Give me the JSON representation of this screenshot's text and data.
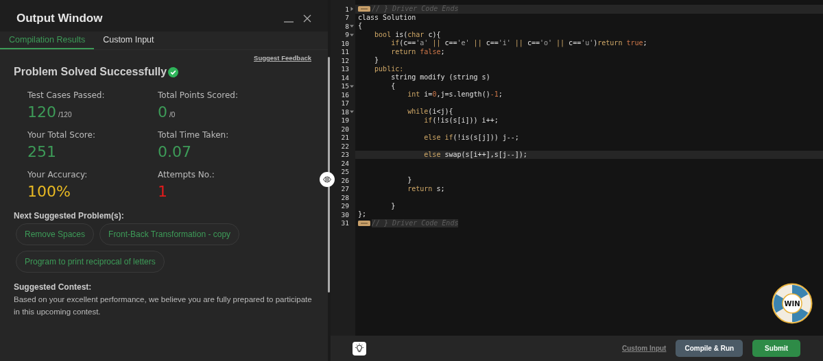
{
  "output_window": {
    "title": "Output Window",
    "tabs": [
      {
        "label": "Compilation Results",
        "selected": true
      },
      {
        "label": "Custom Input",
        "selected": false
      }
    ],
    "feedback_link": "Suggest Feedback",
    "status": "Problem Solved Successfully",
    "stats": [
      {
        "label": "Test Cases Passed:",
        "value": "120",
        "suffix": "/120",
        "color": "#3d9b58"
      },
      {
        "label": "Total Points Scored:",
        "value": "0",
        "suffix": "/0",
        "color": "#3d9b58"
      },
      {
        "label": "Your Total Score:",
        "value": "251",
        "color": "#3d9b58"
      },
      {
        "label": "Total Time Taken:",
        "value": "0.07",
        "color": "#3d9b58"
      },
      {
        "label": "Your Accuracy:",
        "value": "100%",
        "color": "#e8b923"
      },
      {
        "label": "Attempts No.:",
        "value": "1",
        "color": "#e41b1b"
      }
    ],
    "suggested_heading": "Next Suggested Problem(s):",
    "suggested_problems": [
      "Remove Spaces",
      "Front-Back Transformation - copy",
      "Program to print reciprocal of letters"
    ],
    "contest_heading": "Suggested Contest:",
    "contest_text": "Based on your excellent performance, we believe you are fully prepared to participate in this upcoming contest."
  },
  "editor": {
    "lines": [
      {
        "number": "1",
        "foldable": true,
        "collapsed": true,
        "active": true,
        "tokens": [
          {
            "kind": "comment",
            "text": "// } Driver Code Ends"
          }
        ]
      },
      {
        "number": "7",
        "foldable": false,
        "collapsed": false,
        "active": false,
        "tokens": [
          {
            "kind": "plain",
            "text": "class Solution"
          }
        ]
      },
      {
        "number": "8",
        "foldable": true,
        "collapsed": false,
        "active": false,
        "tokens": [
          {
            "kind": "plain",
            "text": "{"
          }
        ]
      },
      {
        "number": "9",
        "foldable": true,
        "collapsed": false,
        "active": false,
        "tokens": [
          {
            "kind": "keyword",
            "text": "    bool"
          },
          {
            "kind": "plain",
            "text": " is("
          },
          {
            "kind": "keyword",
            "text": "char"
          },
          {
            "kind": "plain",
            "text": " c){"
          }
        ]
      },
      {
        "number": "10",
        "foldable": false,
        "collapsed": false,
        "active": false,
        "tokens": [
          {
            "kind": "keyword",
            "text": "        if"
          },
          {
            "kind": "plain",
            "text": "(c=="
          },
          {
            "kind": "string",
            "text": "'a'"
          },
          {
            "kind": "keyword",
            "text": " ||"
          },
          {
            "kind": "plain",
            "text": " c=="
          },
          {
            "kind": "string",
            "text": "'e'"
          },
          {
            "kind": "keyword",
            "text": " ||"
          },
          {
            "kind": "plain",
            "text": " c=="
          },
          {
            "kind": "string",
            "text": "'i'"
          },
          {
            "kind": "keyword",
            "text": " ||"
          },
          {
            "kind": "plain",
            "text": " c=="
          },
          {
            "kind": "string",
            "text": "'o'"
          },
          {
            "kind": "keyword",
            "text": " ||"
          },
          {
            "kind": "plain",
            "text": " c=="
          },
          {
            "kind": "string",
            "text": "'u'"
          },
          {
            "kind": "plain",
            "text": ")"
          },
          {
            "kind": "keyword",
            "text": "return"
          },
          {
            "kind": "literal",
            "text": " true"
          },
          {
            "kind": "plain",
            "text": ";"
          }
        ]
      },
      {
        "number": "11",
        "foldable": false,
        "collapsed": false,
        "active": false,
        "tokens": [
          {
            "kind": "keyword",
            "text": "        return"
          },
          {
            "kind": "literal",
            "text": " false"
          },
          {
            "kind": "plain",
            "text": ";"
          }
        ]
      },
      {
        "number": "12",
        "foldable": false,
        "collapsed": false,
        "active": false,
        "tokens": [
          {
            "kind": "plain",
            "text": "    }"
          }
        ]
      },
      {
        "number": "13",
        "foldable": false,
        "collapsed": false,
        "active": false,
        "tokens": [
          {
            "kind": "keyword",
            "text": "    public:"
          }
        ]
      },
      {
        "number": "14",
        "foldable": false,
        "collapsed": false,
        "active": false,
        "tokens": [
          {
            "kind": "plain",
            "text": "        string modify (string s)"
          }
        ]
      },
      {
        "number": "15",
        "foldable": true,
        "collapsed": false,
        "active": false,
        "tokens": [
          {
            "kind": "plain",
            "text": "        {"
          }
        ]
      },
      {
        "number": "16",
        "foldable": false,
        "collapsed": false,
        "active": false,
        "tokens": [
          {
            "kind": "keyword",
            "text": "            int"
          },
          {
            "kind": "plain",
            "text": " i="
          },
          {
            "kind": "literal",
            "text": "0"
          },
          {
            "kind": "plain",
            "text": ",j=s.length()"
          },
          {
            "kind": "literal",
            "text": "-1"
          },
          {
            "kind": "plain",
            "text": ";"
          }
        ]
      },
      {
        "number": "17",
        "foldable": false,
        "collapsed": false,
        "active": false
      },
      {
        "number": "18",
        "foldable": true,
        "collapsed": false,
        "active": false,
        "tokens": [
          {
            "kind": "keyword",
            "text": "            while"
          },
          {
            "kind": "plain",
            "text": "(i<j){"
          }
        ]
      },
      {
        "number": "19",
        "foldable": false,
        "collapsed": false,
        "active": false,
        "tokens": [
          {
            "kind": "keyword",
            "text": "                if"
          },
          {
            "kind": "plain",
            "text": "(!is(s[i])) i++;"
          }
        ]
      },
      {
        "number": "20",
        "foldable": false,
        "collapsed": false,
        "active": false
      },
      {
        "number": "21",
        "foldable": false,
        "collapsed": false,
        "active": false,
        "tokens": [
          {
            "kind": "keyword",
            "text": "                else if"
          },
          {
            "kind": "plain",
            "text": "(!is(s[j])) j--;"
          }
        ]
      },
      {
        "number": "22",
        "foldable": false,
        "collapsed": false,
        "active": false
      },
      {
        "number": "23",
        "foldable": false,
        "collapsed": false,
        "active": true,
        "tokens": [
          {
            "kind": "keyword",
            "text": "                else"
          },
          {
            "kind": "plain",
            "text": " swap(s[i++],s[j--]);"
          }
        ]
      },
      {
        "number": "24",
        "foldable": false,
        "collapsed": false,
        "active": false
      },
      {
        "number": "25",
        "foldable": false,
        "collapsed": false,
        "active": false
      },
      {
        "number": "26",
        "foldable": false,
        "collapsed": false,
        "active": false,
        "tokens": [
          {
            "kind": "plain",
            "text": "            }"
          }
        ]
      },
      {
        "number": "27",
        "foldable": false,
        "collapsed": false,
        "active": false,
        "tokens": [
          {
            "kind": "keyword",
            "text": "            return"
          },
          {
            "kind": "plain",
            "text": " s;"
          }
        ]
      },
      {
        "number": "28",
        "foldable": false,
        "collapsed": false,
        "active": false
      },
      {
        "number": "29",
        "foldable": false,
        "collapsed": false,
        "active": false,
        "tokens": [
          {
            "kind": "plain",
            "text": "        }"
          }
        ]
      },
      {
        "number": "30",
        "foldable": false,
        "collapsed": false,
        "active": false,
        "tokens": [
          {
            "kind": "plain",
            "text": "};"
          }
        ]
      },
      {
        "number": "31",
        "foldable": false,
        "collapsed": true,
        "active": false,
        "tokens": [
          {
            "kind": "comment",
            "text": "// } Driver Code Ends"
          }
        ]
      }
    ],
    "win_badge": "WIN",
    "custom_input_link": "Custom Input",
    "buttons": [
      {
        "label": "Compile & Run",
        "kind": "secondary"
      },
      {
        "label": "Submit",
        "kind": "primary"
      }
    ]
  }
}
